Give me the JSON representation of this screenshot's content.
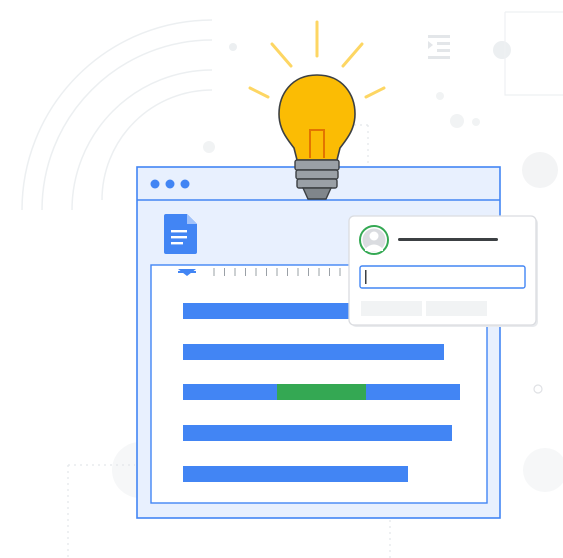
{
  "illustration": {
    "subject": "",
    "window_dots": 3,
    "document_lines": 5,
    "highlighted_line_index": 2,
    "comment_popup": {
      "has_avatar": true,
      "input_value": "",
      "button_count": 2
    }
  },
  "colors": {
    "window_frame": "#4285f4",
    "window_fill": "#e8f0fe",
    "dot": "#4285f4",
    "doc_icon": "#4285f4",
    "line_blue": "#4285f4",
    "line_green": "#34a853",
    "bulb_yellow": "#fbbc04",
    "bulb_outline": "#3c4043",
    "bulb_base": "#9aa0a6",
    "rays": "#fdd663",
    "popup_border": "#dadce0",
    "avatar_bg": "#dadce0",
    "avatar_ring": "#34a853",
    "input_border": "#4285f4",
    "popup_button": "#f1f3f4",
    "background_decor": "#f1f3f4"
  }
}
